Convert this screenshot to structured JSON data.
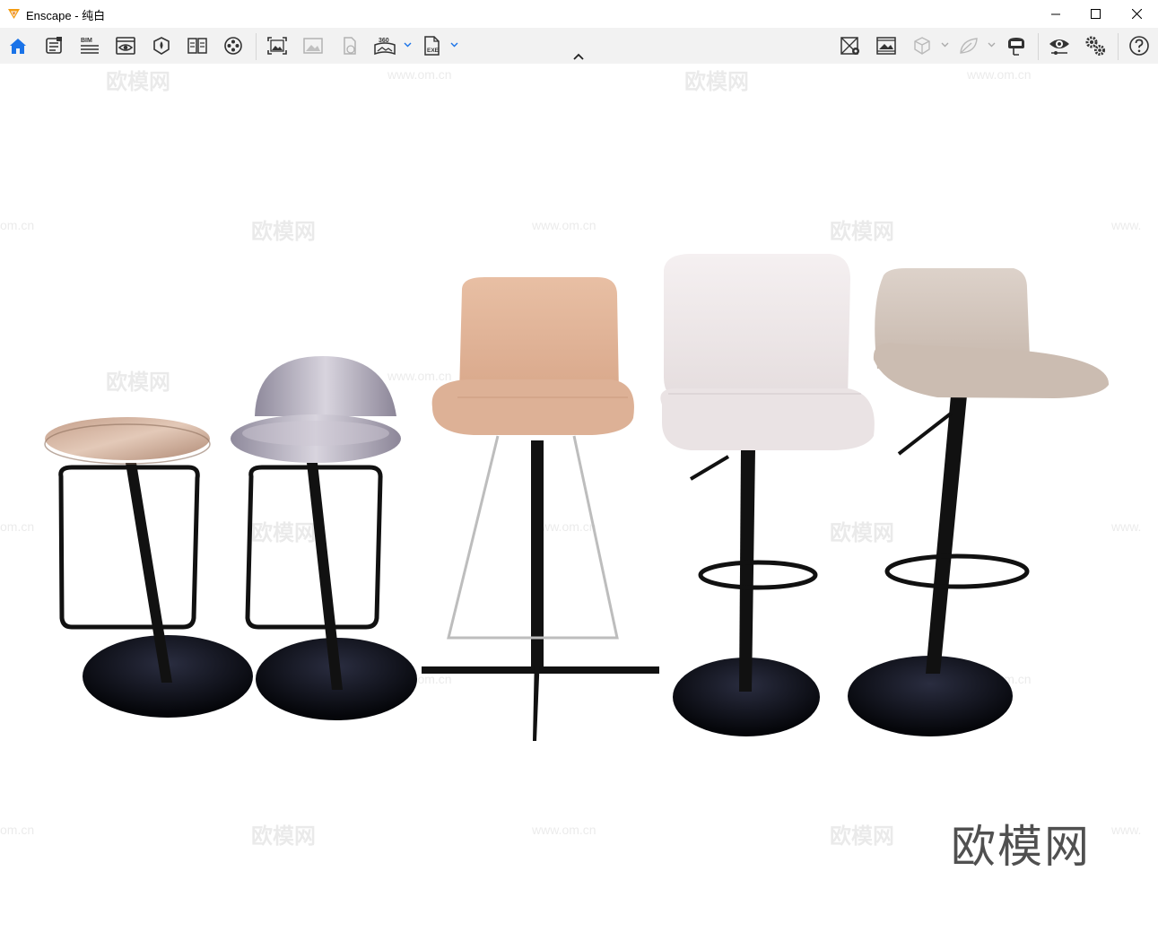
{
  "window": {
    "app_name": "Enscape",
    "separator": " - ",
    "scene_name": "纯白",
    "minimize_icon": "minimize-icon",
    "maximize_icon": "maximize-icon",
    "close_icon": "close-icon"
  },
  "toolbar": {
    "left_items": [
      {
        "name": "home",
        "icon": "home-icon",
        "active": true
      },
      {
        "name": "asset-library",
        "icon": "asset-library-icon",
        "active": false
      },
      {
        "name": "bim-info",
        "icon": "bim-icon",
        "label": "BIM",
        "active": false
      },
      {
        "name": "view-management",
        "icon": "view-management-icon",
        "active": false
      },
      {
        "name": "material-editor",
        "icon": "material-editor-icon",
        "active": false
      },
      {
        "name": "book-view",
        "icon": "book-icon",
        "active": false
      },
      {
        "name": "video-editor",
        "icon": "film-reel-icon",
        "active": false
      },
      {
        "name": "render-image",
        "icon": "render-image-icon",
        "active": false
      },
      {
        "name": "batch-render",
        "icon": "batch-render-icon",
        "active": false,
        "disabled": true
      },
      {
        "name": "upload",
        "icon": "upload-icon",
        "active": false,
        "disabled": true
      },
      {
        "name": "panorama",
        "icon": "panorama-360-icon",
        "label": "360",
        "active": false
      },
      {
        "name": "export-exe",
        "icon": "export-exe-icon",
        "label": "EXE",
        "active": false
      }
    ],
    "right_items": [
      {
        "name": "map-view",
        "icon": "map-icon"
      },
      {
        "name": "image-settings",
        "icon": "image-settings-icon"
      },
      {
        "name": "cube-view",
        "icon": "cube-icon",
        "disabled": true
      },
      {
        "name": "leaf-view",
        "icon": "leaf-icon",
        "disabled": true
      },
      {
        "name": "vr-headset",
        "icon": "vr-headset-icon"
      },
      {
        "name": "visual-settings",
        "icon": "eye-settings-icon"
      },
      {
        "name": "general-settings",
        "icon": "gears-icon"
      },
      {
        "name": "help",
        "icon": "help-icon"
      }
    ],
    "collapse_icon": "chevron-up-icon"
  },
  "viewport": {
    "watermark_cn": "欧模网",
    "watermark_url": "www.om.cn",
    "watermark_url_partial_left": "om.cn",
    "watermark_url_partial_right": "www.",
    "brand_mark": "欧模网"
  },
  "colors": {
    "toolbar_bg": "#f2f2f2",
    "accent_blue": "#1a73e8",
    "icon_dark": "#333333",
    "logo_orange": "#f39c12"
  }
}
